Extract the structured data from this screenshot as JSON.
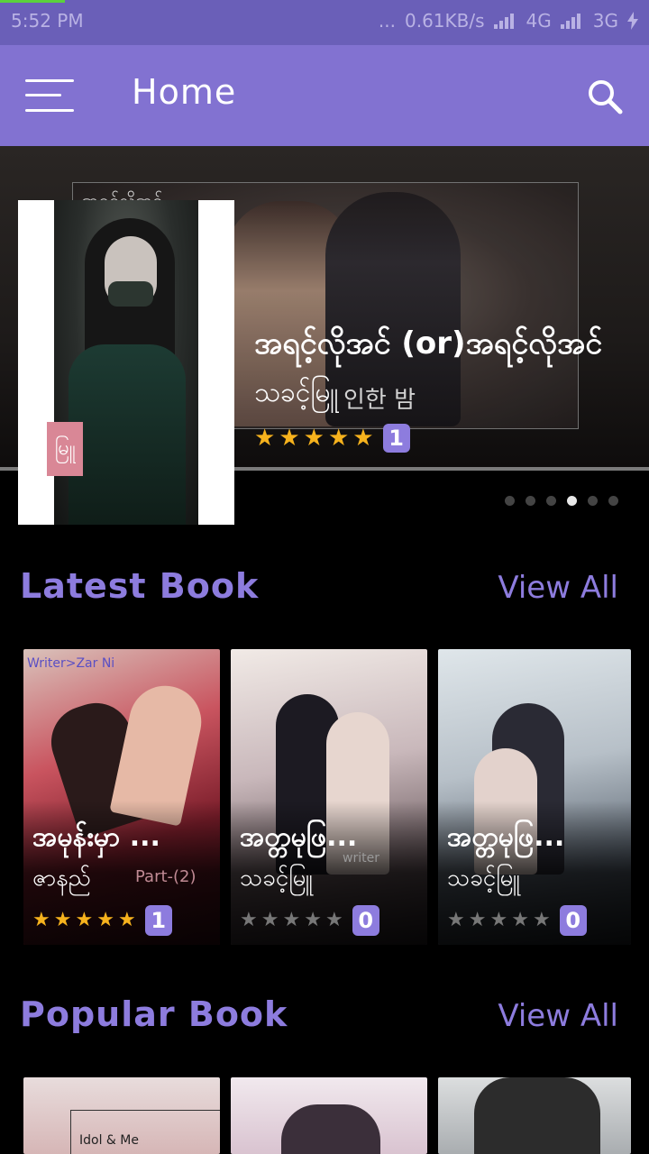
{
  "status_bar": {
    "time": "5:52 PM",
    "dots": "...",
    "speed": "0.61KB/s",
    "net1": "4G",
    "net2": "3G"
  },
  "app_bar": {
    "title": "Home",
    "menu_icon": "hamburger-menu-icon",
    "search_icon": "search-icon"
  },
  "hero": {
    "title": "အရင့်လိုအင် (or)အရင့်လိုအင်",
    "author": "သခင့်မြူ",
    "rating_stars": 5,
    "rating_count": "1",
    "background_caption": "အရင့်လိုအင်",
    "background_korean": "인한 밤",
    "stamp": "မြူ",
    "carousel_pages": 6,
    "carousel_active_index": 3
  },
  "latest": {
    "heading": "Latest Book",
    "view_all": "View All",
    "books": [
      {
        "title": "အမုန်းမှာ ...",
        "author": "ဇာနည်",
        "stars": 5,
        "count": "1",
        "overlay": "Writer>Zar Ni",
        "part": "Part-(2)"
      },
      {
        "title": "အတ္တမုဖြ...",
        "author": "သခင့်မြူ",
        "stars": 0,
        "count": "0",
        "overlay": "writer",
        "part": ""
      },
      {
        "title": "အတ္တမုဖြ...",
        "author": "သခင့်မြူ",
        "stars": 0,
        "count": "0",
        "overlay": "",
        "part": ""
      }
    ]
  },
  "popular": {
    "heading": "Popular Book",
    "view_all": "View All",
    "books": [
      {
        "overlay": "Idol & Me"
      },
      {
        "overlay": ""
      },
      {
        "overlay": ""
      }
    ]
  },
  "colors": {
    "accent": "#8d7cde",
    "app_bar": "#8272d1",
    "status_bar": "#6a5fb8",
    "star": "#f6b21d"
  }
}
